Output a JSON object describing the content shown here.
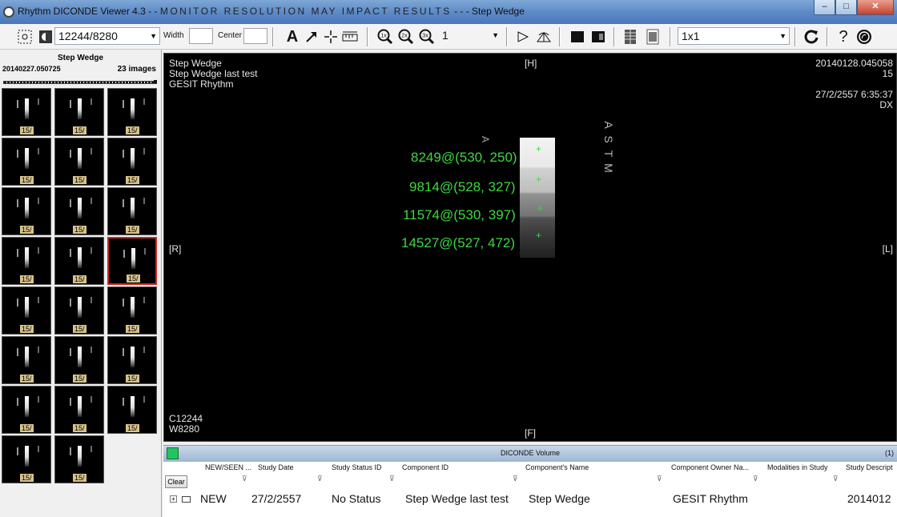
{
  "window": {
    "app_title": "Rhythm DICONDE Viewer 4.3 - -",
    "warning": "MONITOR RESOLUTION MAY IMPACT RESULTS",
    "suffix": "- - - Step Wedge",
    "minimize": "–",
    "maximize": "□",
    "close": "✕"
  },
  "toolbar": {
    "series_combo": "12244/8280",
    "width_label": "Width",
    "center_label": "Center",
    "zoom_value": "1",
    "layout_value": "1x1"
  },
  "left_panel": {
    "header": "Step Wedge",
    "date": "20140227.050725",
    "count": "23 images",
    "thumb_caption": "15/"
  },
  "viewer": {
    "top_left": [
      "Step Wedge",
      "Step Wedge last test",
      "GESIT Rhythm"
    ],
    "top_center": "[H]",
    "top_right": [
      "20140128.045058",
      "15",
      "",
      "27/2/2557 6:35:37",
      "DX"
    ],
    "left_marker": "[R]",
    "right_marker": "[L]",
    "bottom_center": "[F]",
    "bottom_left": [
      "C12244",
      "W8280"
    ],
    "measurements": [
      "8249@(530, 250)",
      "9814@(528, 327)",
      "11574@(530, 397)",
      "14527@(527, 472)"
    ],
    "marker_plus": "+",
    "astm_text": "ASTM"
  },
  "volume_panel": {
    "title": "DICONDE Volume",
    "count": "(1)",
    "clear_button": "Clear",
    "columns": [
      "NEW/SEEN ...",
      "Study Date",
      "Study Status ID",
      "Component ID",
      "Component's Name",
      "Component Owner Na...",
      "Modalities in Study",
      "Study Descript"
    ],
    "row": {
      "status": "NEW",
      "study_date": "27/2/2557",
      "status_id": "No Status",
      "component_id": "Step Wedge last test",
      "component_name": "Step Wedge",
      "owner": "GESIT Rhythm",
      "description": "2014012"
    }
  }
}
